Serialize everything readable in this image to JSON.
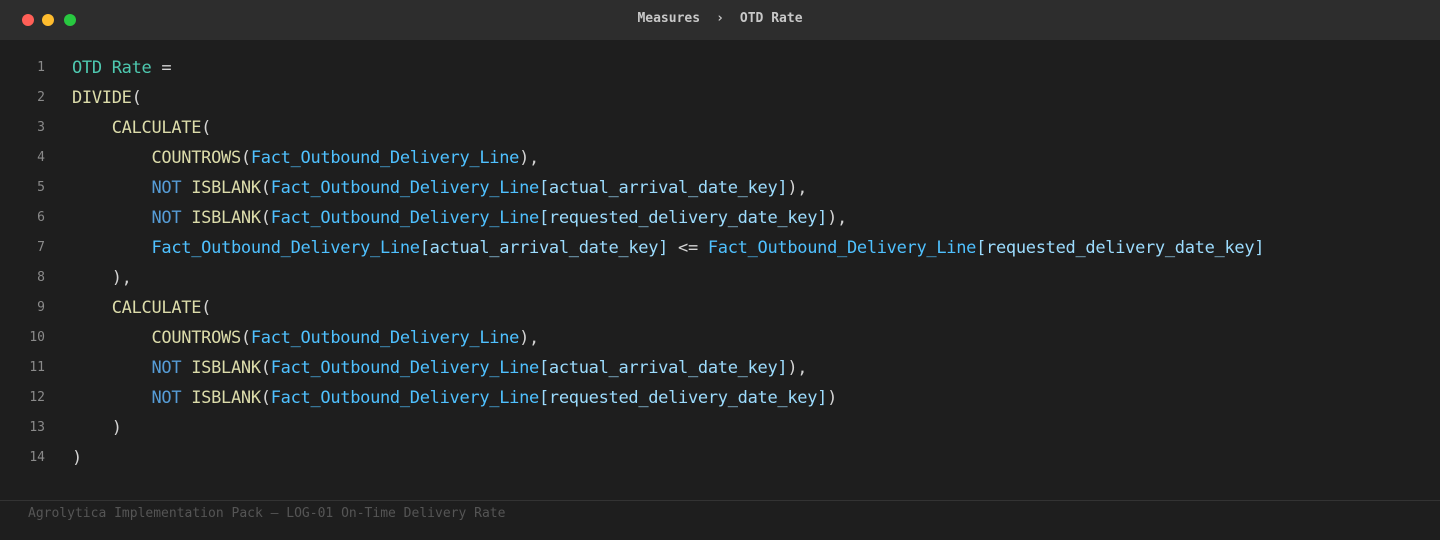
{
  "window": {
    "breadcrumb": [
      "Measures",
      "OTD Rate"
    ],
    "breadcrumb_separator": "›"
  },
  "colors": {
    "background": "#1e1e1e",
    "titlebar": "#2d2d2d",
    "measure": "#4ec9b0",
    "function": "#dcdcaa",
    "keyword": "#569cd6",
    "table": "#4fc1ff",
    "column": "#9cdcfe",
    "punctuation": "#d4d4d4"
  },
  "editor": {
    "lines": [
      {
        "number": "1",
        "indent": "",
        "tokens": [
          {
            "t": "OTD Rate",
            "k": "measure"
          },
          {
            "t": " =",
            "k": "punc"
          }
        ]
      },
      {
        "number": "2",
        "indent": "",
        "tokens": [
          {
            "t": "DIVIDE",
            "k": "func"
          },
          {
            "t": "(",
            "k": "punc"
          }
        ]
      },
      {
        "number": "3",
        "indent": "    ",
        "tokens": [
          {
            "t": "CALCULATE",
            "k": "func"
          },
          {
            "t": "(",
            "k": "punc"
          }
        ]
      },
      {
        "number": "4",
        "indent": "        ",
        "tokens": [
          {
            "t": "COUNTROWS",
            "k": "func"
          },
          {
            "t": "(",
            "k": "punc"
          },
          {
            "t": "Fact_Outbound_Delivery_Line",
            "k": "table"
          },
          {
            "t": "),",
            "k": "punc"
          }
        ]
      },
      {
        "number": "5",
        "indent": "        ",
        "tokens": [
          {
            "t": "NOT",
            "k": "kw"
          },
          {
            "t": " ",
            "k": "punc"
          },
          {
            "t": "ISBLANK",
            "k": "func"
          },
          {
            "t": "(",
            "k": "punc"
          },
          {
            "t": "Fact_Outbound_Delivery_Line",
            "k": "table"
          },
          {
            "t": "[actual_arrival_date_key]",
            "k": "col"
          },
          {
            "t": "),",
            "k": "punc"
          }
        ]
      },
      {
        "number": "6",
        "indent": "        ",
        "tokens": [
          {
            "t": "NOT",
            "k": "kw"
          },
          {
            "t": " ",
            "k": "punc"
          },
          {
            "t": "ISBLANK",
            "k": "func"
          },
          {
            "t": "(",
            "k": "punc"
          },
          {
            "t": "Fact_Outbound_Delivery_Line",
            "k": "table"
          },
          {
            "t": "[requested_delivery_date_key]",
            "k": "col"
          },
          {
            "t": "),",
            "k": "punc"
          }
        ]
      },
      {
        "number": "7",
        "indent": "        ",
        "tokens": [
          {
            "t": "Fact_Outbound_Delivery_Line",
            "k": "table"
          },
          {
            "t": "[actual_arrival_date_key]",
            "k": "col"
          },
          {
            "t": " <= ",
            "k": "punc"
          },
          {
            "t": "Fact_Outbound_Delivery_Line",
            "k": "table"
          },
          {
            "t": "[requested_delivery_date_key]",
            "k": "col"
          }
        ]
      },
      {
        "number": "8",
        "indent": "    ",
        "tokens": [
          {
            "t": "),",
            "k": "punc"
          }
        ]
      },
      {
        "number": "9",
        "indent": "    ",
        "tokens": [
          {
            "t": "CALCULATE",
            "k": "func"
          },
          {
            "t": "(",
            "k": "punc"
          }
        ]
      },
      {
        "number": "10",
        "indent": "        ",
        "tokens": [
          {
            "t": "COUNTROWS",
            "k": "func"
          },
          {
            "t": "(",
            "k": "punc"
          },
          {
            "t": "Fact_Outbound_Delivery_Line",
            "k": "table"
          },
          {
            "t": "),",
            "k": "punc"
          }
        ]
      },
      {
        "number": "11",
        "indent": "        ",
        "tokens": [
          {
            "t": "NOT",
            "k": "kw"
          },
          {
            "t": " ",
            "k": "punc"
          },
          {
            "t": "ISBLANK",
            "k": "func"
          },
          {
            "t": "(",
            "k": "punc"
          },
          {
            "t": "Fact_Outbound_Delivery_Line",
            "k": "table"
          },
          {
            "t": "[actual_arrival_date_key]",
            "k": "col"
          },
          {
            "t": "),",
            "k": "punc"
          }
        ]
      },
      {
        "number": "12",
        "indent": "        ",
        "tokens": [
          {
            "t": "NOT",
            "k": "kw"
          },
          {
            "t": " ",
            "k": "punc"
          },
          {
            "t": "ISBLANK",
            "k": "func"
          },
          {
            "t": "(",
            "k": "punc"
          },
          {
            "t": "Fact_Outbound_Delivery_Line",
            "k": "table"
          },
          {
            "t": "[requested_delivery_date_key]",
            "k": "col"
          },
          {
            "t": ")",
            "k": "punc"
          }
        ]
      },
      {
        "number": "13",
        "indent": "    ",
        "tokens": [
          {
            "t": ")",
            "k": "punc"
          }
        ]
      },
      {
        "number": "14",
        "indent": "",
        "tokens": [
          {
            "t": ")",
            "k": "punc"
          }
        ]
      }
    ]
  },
  "footer": {
    "text": "Agrolytica Implementation Pack — LOG-01 On-Time Delivery Rate"
  }
}
